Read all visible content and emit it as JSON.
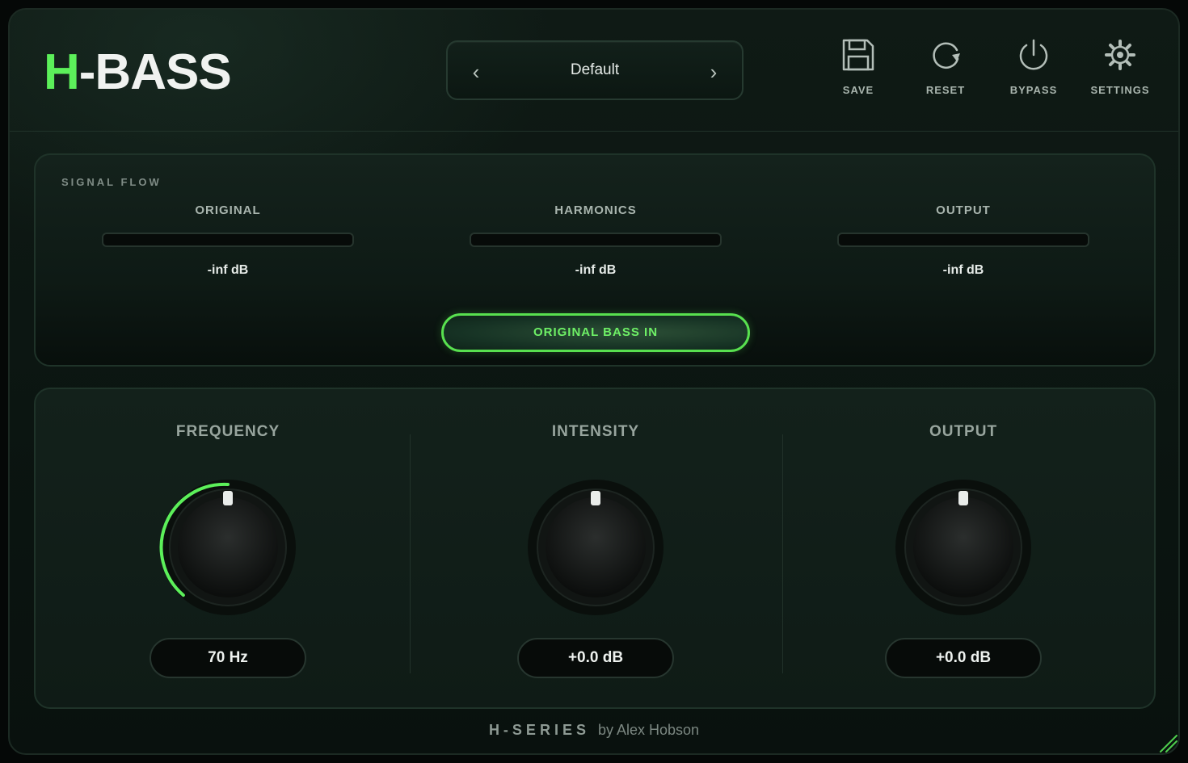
{
  "header": {
    "logo": {
      "accent": "H",
      "rest": "-BASS"
    },
    "preset": {
      "name": "Default",
      "prev_icon": "‹",
      "next_icon": "›"
    },
    "toolbar": [
      {
        "id": "save",
        "label": "SAVE",
        "icon": "floppy-disk-icon"
      },
      {
        "id": "reset",
        "label": "RESET",
        "icon": "refresh-icon"
      },
      {
        "id": "bypass",
        "label": "BYPASS",
        "icon": "power-icon"
      },
      {
        "id": "settings",
        "label": "SETTINGS",
        "icon": "gear-icon"
      }
    ]
  },
  "signal_flow": {
    "title": "SIGNAL FLOW",
    "meters": [
      {
        "label": "ORIGINAL",
        "value": "-inf dB"
      },
      {
        "label": "HARMONICS",
        "value": "-inf dB"
      },
      {
        "label": "OUTPUT",
        "value": "-inf dB"
      }
    ],
    "toggle_label": "ORIGINAL BASS IN"
  },
  "knobs": [
    {
      "label": "FREQUENCY",
      "value": "70 Hz"
    },
    {
      "label": "INTENSITY",
      "value": "+0.0 dB"
    },
    {
      "label": "OUTPUT",
      "value": "+0.0 dB"
    }
  ],
  "footer": {
    "brand": "H-SERIES",
    "credit": "by Alex Hobson"
  },
  "colors": {
    "accent": "#5cf05a",
    "background": "#0b1511",
    "panel": "#13211b",
    "text": "#e6ebe8",
    "muted": "#a9b5ae"
  }
}
